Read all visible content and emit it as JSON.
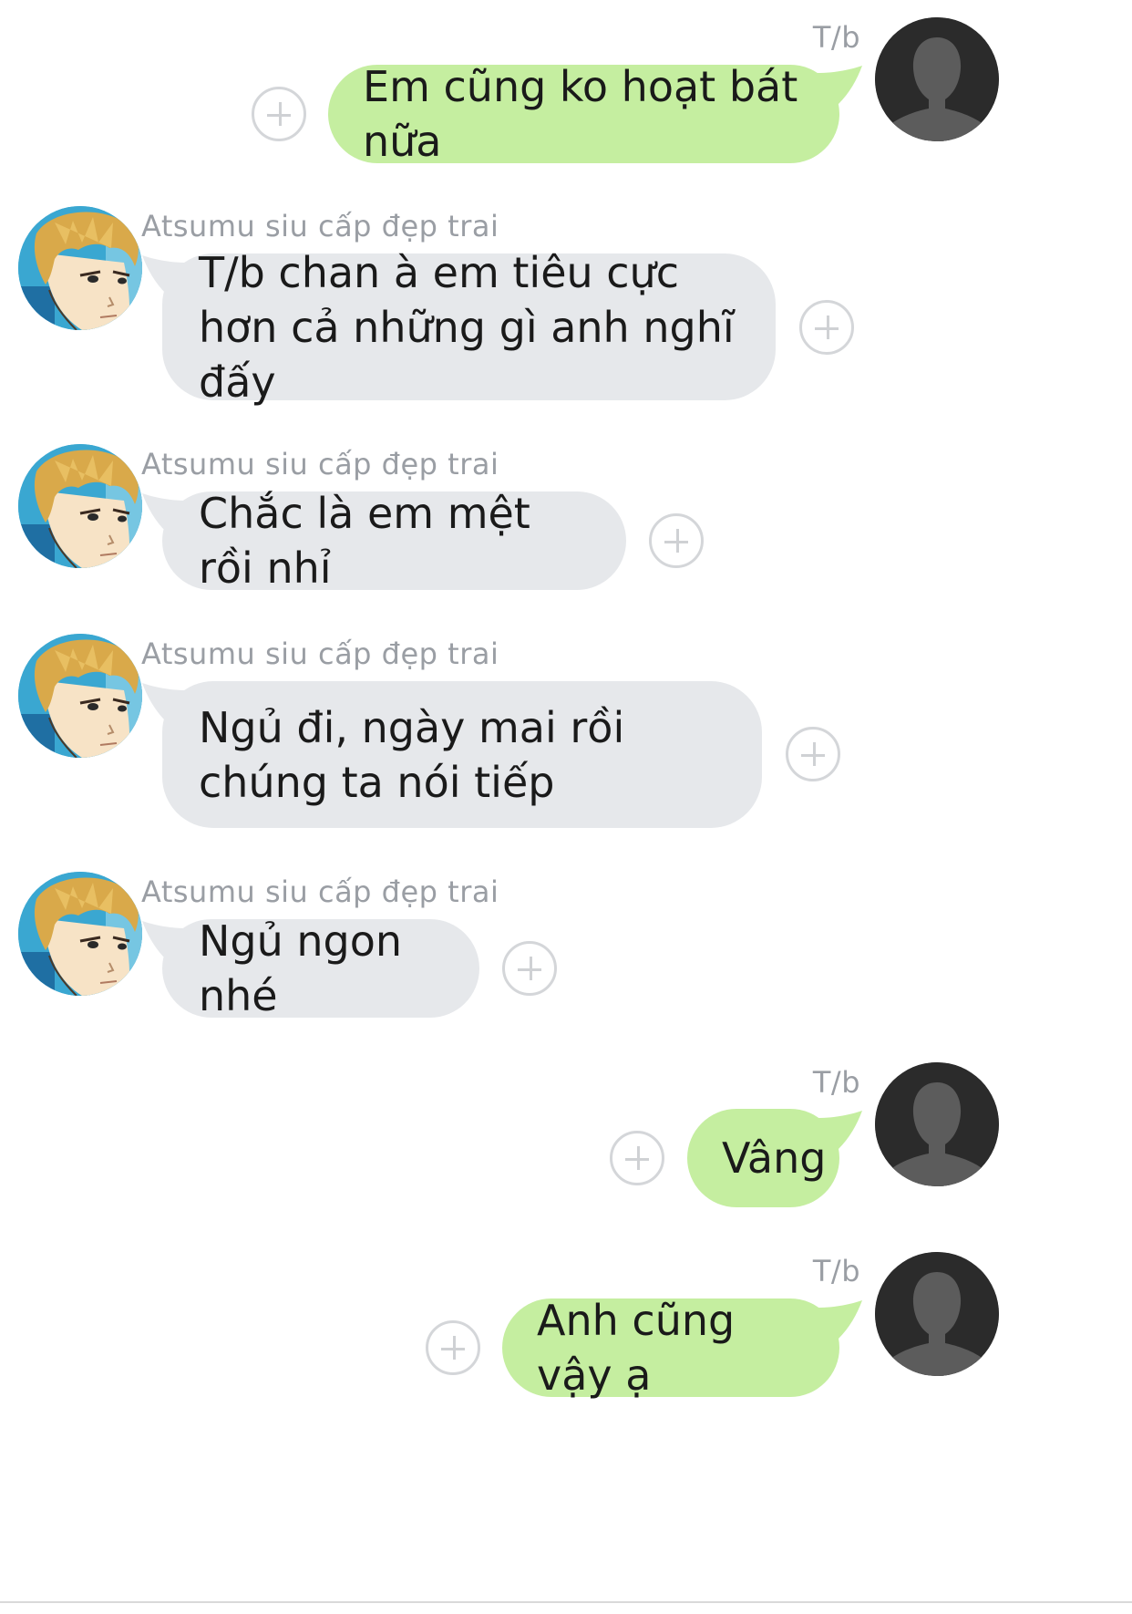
{
  "colors": {
    "outgoing_bubble": "#c5eea0",
    "incoming_bubble": "#e6e8eb",
    "name_text": "#9a9ea4"
  },
  "messages": [
    {
      "sender": "T/b",
      "direction": "outgoing",
      "text": "Em cũng ko hoạt bát nữa"
    },
    {
      "sender": "Atsumu siu cấp đẹp trai",
      "direction": "incoming",
      "text": "T/b chan à em tiêu cực hơn cả những gì anh nghĩ đấy"
    },
    {
      "sender": "Atsumu siu cấp đẹp trai",
      "direction": "incoming",
      "text": "Chắc là em mệt rồi nhỉ"
    },
    {
      "sender": "Atsumu siu cấp đẹp trai",
      "direction": "incoming",
      "text": "Ngủ đi, ngày mai rồi chúng ta nói tiếp"
    },
    {
      "sender": "Atsumu siu cấp đẹp trai",
      "direction": "incoming",
      "text": "Ngủ ngon nhé"
    },
    {
      "sender": "T/b",
      "direction": "outgoing",
      "text": "Vâng"
    },
    {
      "sender": "T/b",
      "direction": "outgoing",
      "text": "Anh cũng vậy ạ"
    }
  ],
  "icons": {
    "reaction": "add-reaction-icon",
    "my_avatar": "default-person-silhouette",
    "other_avatar": "anime-character-portrait"
  }
}
